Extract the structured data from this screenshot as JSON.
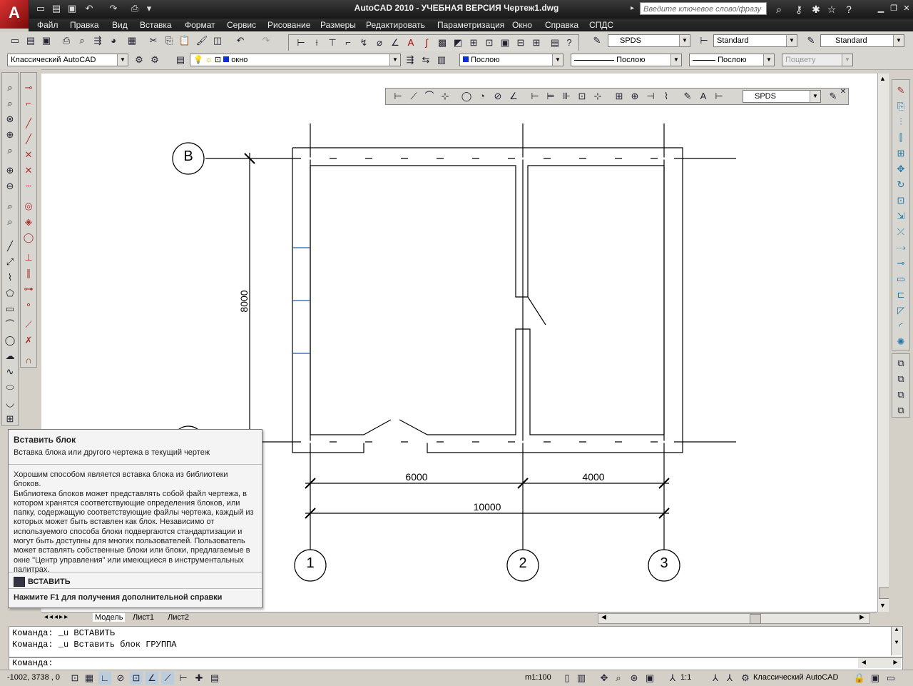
{
  "window": {
    "title": "AutoCAD 2010 - УЧЕБНАЯ ВЕРСИЯ    Чертеж1.dwg",
    "search_placeholder": "Введите ключевое слово/фразу",
    "logo": "A"
  },
  "menu": [
    "Файл",
    "Правка",
    "Вид",
    "Вставка",
    "Формат",
    "Сервис",
    "Рисование",
    "Размеры",
    "Редактировать",
    "Параметризация",
    "Окно",
    "Справка",
    "СПДС"
  ],
  "toolbar": {
    "text_style": "SPDS",
    "dim_style": "Standard",
    "table_style": "Standard",
    "workspace": "Классический AutoCAD",
    "layer": "окно",
    "color": "Послою",
    "linetype": "Послою",
    "lineweight": "Послою",
    "plotstyle": "Поцвету",
    "spds_style": "SPDS"
  },
  "drawing": {
    "axis_b": "В",
    "axis_1": "1",
    "axis_2": "2",
    "axis_3": "3",
    "dim_height": "8000",
    "dim_6000": "6000",
    "dim_4000": "4000",
    "dim_total": "10000"
  },
  "tabs": [
    "Модель",
    "Лист1",
    "Лист2"
  ],
  "command": {
    "history": [
      "Команда: _u ВСТАВИТЬ",
      "Команда: _u Вставить блок ГРУППА"
    ],
    "prompt": "Команда:"
  },
  "status": {
    "coords": "-1002, 3738 , 0",
    "scale": "m1:100",
    "annotation_scale": "1:1",
    "workspace": "Классический AutoCAD"
  },
  "tooltip": {
    "title": "Вставить блок",
    "subtitle": "Вставка блока или другого чертежа в текущий чертеж",
    "lines": [
      "Хорошим способом является вставка блока из библиотеки блоков.",
      "Библиотека блоков может представлять собой файл чертежа, в",
      "котором хранятся соответствующие определения блоков, или",
      "папку, содержащую соответствующие файлы чертежа, каждый из",
      "которых может быть вставлен как блок. Независимо от",
      "используемого способа блоки подвергаются стандартизации и",
      "могут быть доступны для многих пользователей. Пользователь",
      "может вставлять собственные блоки или блоки, предлагаемые в",
      "окне \"Центр управления\" или имеющиеся в инструментальных",
      "палитрах."
    ],
    "command": "ВСТАВИТЬ",
    "help": "Нажмите F1 для получения дополнительной справки"
  },
  "colors": {
    "layer_color": "#0a2fe0",
    "title_bg": "#1d1d1d"
  }
}
